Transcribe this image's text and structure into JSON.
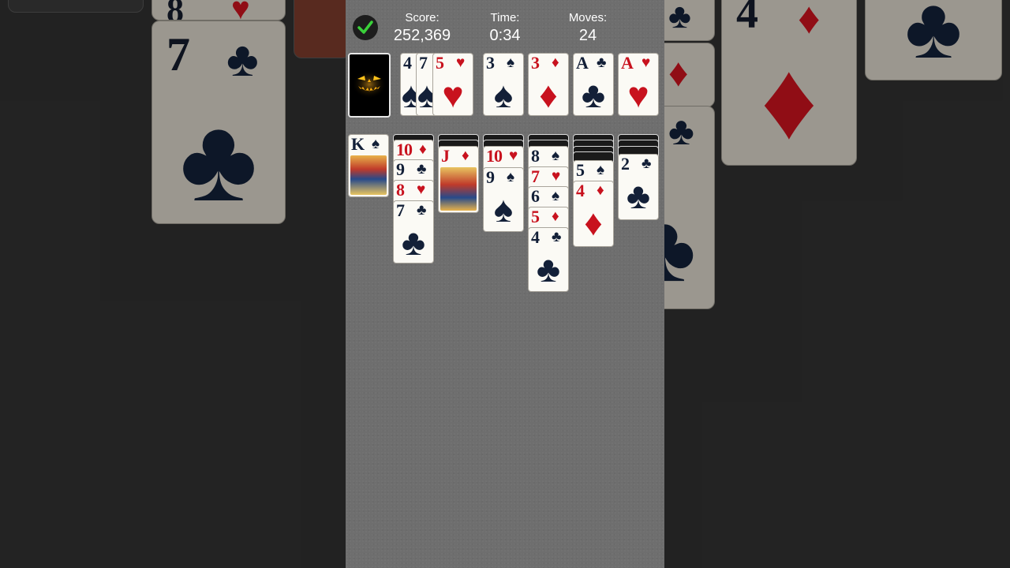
{
  "hud": {
    "score_label": "Score:",
    "score_value": "252,369",
    "time_label": "Time:",
    "time_value": "0:34",
    "moves_label": "Moves:",
    "moves_value": "24"
  },
  "colors": {
    "red": "#c8121e",
    "black": "#132038",
    "table": "#6e6e6e"
  },
  "stock": {
    "back_design": "jack-o-lantern"
  },
  "waste": [
    {
      "rank": "4",
      "suit": "♠"
    },
    {
      "rank": "7",
      "suit": "♠"
    },
    {
      "rank": "5",
      "suit": "♥"
    }
  ],
  "foundations": [
    {
      "rank": "3",
      "suit": "♠"
    },
    {
      "rank": "3",
      "suit": "♦"
    },
    {
      "rank": "A",
      "suit": "♣"
    },
    {
      "rank": "A",
      "suit": "♥"
    }
  ],
  "tableau": {
    "col1": [
      {
        "rank": "K",
        "suit": "♠"
      }
    ],
    "col2": [
      {
        "rank": "10",
        "suit": "♦"
      },
      {
        "rank": "9",
        "suit": "♣"
      },
      {
        "rank": "8",
        "suit": "♥"
      },
      {
        "rank": "7",
        "suit": "♣"
      }
    ],
    "col3": [
      {
        "rank": "J",
        "suit": "♦"
      }
    ],
    "col4": [
      {
        "rank": "10",
        "suit": "♥"
      },
      {
        "rank": "9",
        "suit": "♠"
      }
    ],
    "col5": [
      {
        "rank": "8",
        "suit": "♠"
      },
      {
        "rank": "7",
        "suit": "♥"
      },
      {
        "rank": "6",
        "suit": "♠"
      },
      {
        "rank": "5",
        "suit": "♦"
      },
      {
        "rank": "4",
        "suit": "♣"
      }
    ],
    "col6": [
      {
        "rank": "5",
        "suit": "♠"
      },
      {
        "rank": "4",
        "suit": "♦"
      }
    ],
    "col7": [
      {
        "rank": "2",
        "suit": "♣"
      }
    ]
  },
  "background_cards": [
    {
      "rank": "8",
      "suit": "♥"
    },
    {
      "rank": "7",
      "suit": "♣"
    },
    {
      "rank": "4",
      "suit": "♦"
    },
    {
      "rank": "",
      "suit": "♦"
    },
    {
      "rank": "",
      "suit": "♣"
    }
  ]
}
